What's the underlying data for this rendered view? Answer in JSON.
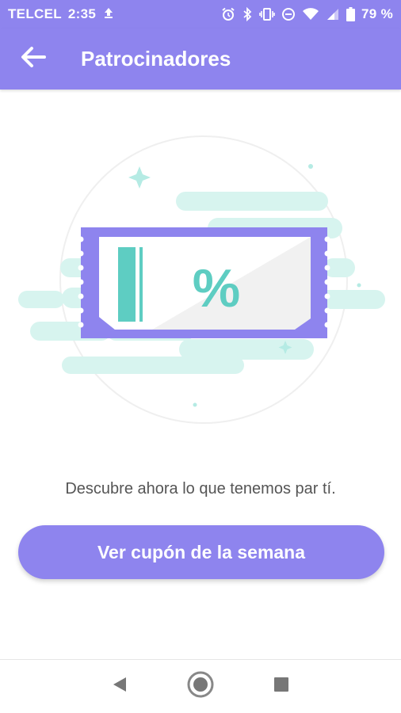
{
  "status_bar": {
    "carrier": "TELCEL",
    "time": "2:35",
    "battery": "79 %",
    "icons": [
      "upload-icon",
      "alarm-icon",
      "bluetooth-icon",
      "vibrate-icon",
      "dnd-icon",
      "wifi-icon",
      "signal-icon",
      "battery-icon"
    ]
  },
  "header": {
    "title": "Patrocinadores",
    "back_icon": "arrow-left-icon"
  },
  "illustration": {
    "symbol": "%",
    "description_icon": "coupon-ticket-icon"
  },
  "main": {
    "tagline": "Descubre ahora lo que tenemos par tí.",
    "cta_label": "Ver cupón de la semana"
  },
  "nav": {
    "icons": [
      "back-triangle-icon",
      "home-circle-icon",
      "recents-square-icon"
    ]
  },
  "colors": {
    "primary": "#8e84ee",
    "teal": "#5ecdc2",
    "teal_light": "#d7f4ef"
  }
}
